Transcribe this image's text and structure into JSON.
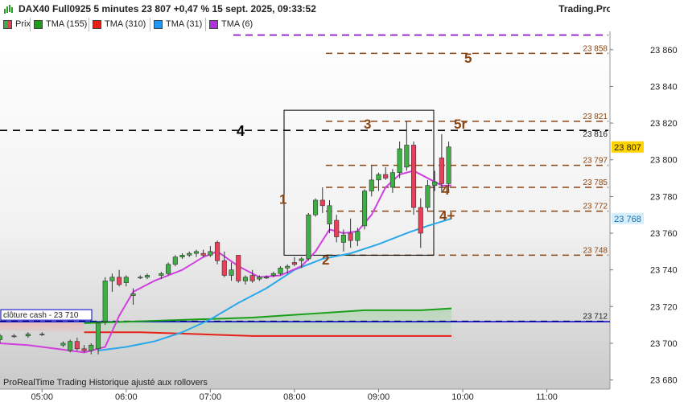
{
  "header": {
    "title": "DAX40 Full0925 5 minutes 23 807 +0,47 % 15 sept. 2025, 09:33:52",
    "brand": "Trading.ProRealTime.com"
  },
  "legend": [
    {
      "label": "Prix",
      "color": "#3cb043"
    },
    {
      "label": "TMA (155)",
      "color": "#1a9e1a"
    },
    {
      "label": "TMA (310)",
      "color": "#e8201a"
    },
    {
      "label": "TMA (31)",
      "color": "#2196f3"
    },
    {
      "label": "TMA (6)",
      "color": "#b030e0"
    }
  ],
  "footnote": "ProRealTime Trading  Historique ajusté aux rollovers",
  "colors": {
    "up": "#3cb043",
    "down": "#e8405a",
    "level": "#8b4513",
    "black_level": "#000000",
    "purple_level": "#9b30d0",
    "cash_line": "#0000cc"
  },
  "chart_data": {
    "type": "candlestick",
    "title": "DAX40 Full0925 5 minutes",
    "ylim": [
      23675,
      23870
    ],
    "yticks": [
      23680,
      23700,
      23720,
      23740,
      23760,
      23780,
      23800,
      23820,
      23840,
      23860
    ],
    "ytick_labels": [
      "23 680",
      "23 700",
      "23 720",
      "23 740",
      "23 760",
      "23 780",
      "23 800",
      "23 820",
      "23 840",
      "23 860"
    ],
    "xticks": [
      {
        "t": "05:00",
        "m": 300
      },
      {
        "t": "06:00",
        "m": 360
      },
      {
        "t": "07:00",
        "m": 420
      },
      {
        "t": "08:00",
        "m": 480
      },
      {
        "t": "09:00",
        "m": 540
      },
      {
        "t": "10:00",
        "m": 600
      },
      {
        "t": "11:00",
        "m": 660
      }
    ],
    "xlim_minutes": [
      270,
      705
    ],
    "candles": [
      {
        "m": 270,
        "o": 23702,
        "h": 23705,
        "l": 23700,
        "c": 23704
      },
      {
        "m": 280,
        "o": 23704,
        "h": 23705,
        "l": 23703,
        "c": 23704
      },
      {
        "m": 290,
        "o": 23704,
        "h": 23706,
        "l": 23703,
        "c": 23705
      },
      {
        "m": 300,
        "o": 23705,
        "h": 23706,
        "l": 23704,
        "c": 23705
      },
      {
        "m": 315,
        "o": 23699,
        "h": 23701,
        "l": 23698,
        "c": 23700
      },
      {
        "m": 320,
        "o": 23696,
        "h": 23702,
        "l": 23695,
        "c": 23701
      },
      {
        "m": 325,
        "o": 23701,
        "h": 23703,
        "l": 23696,
        "c": 23697
      },
      {
        "m": 330,
        "o": 23697,
        "h": 23699,
        "l": 23695,
        "c": 23696
      },
      {
        "m": 335,
        "o": 23696,
        "h": 23700,
        "l": 23694,
        "c": 23699
      },
      {
        "m": 340,
        "o": 23697,
        "h": 23712,
        "l": 23694,
        "c": 23711
      },
      {
        "m": 345,
        "o": 23712,
        "h": 23736,
        "l": 23710,
        "c": 23734
      },
      {
        "m": 350,
        "o": 23734,
        "h": 23738,
        "l": 23728,
        "c": 23736
      },
      {
        "m": 355,
        "o": 23736,
        "h": 23740,
        "l": 23731,
        "c": 23732
      },
      {
        "m": 360,
        "o": 23733,
        "h": 23737,
        "l": 23731,
        "c": 23736
      },
      {
        "m": 365,
        "o": 23726,
        "h": 23730,
        "l": 23721,
        "c": 23727
      },
      {
        "m": 370,
        "o": 23736,
        "h": 23737,
        "l": 23735,
        "c": 23736
      },
      {
        "m": 375,
        "o": 23736,
        "h": 23738,
        "l": 23735,
        "c": 23737
      },
      {
        "m": 385,
        "o": 23737,
        "h": 23739,
        "l": 23735,
        "c": 23738
      },
      {
        "m": 390,
        "o": 23738,
        "h": 23744,
        "l": 23737,
        "c": 23743
      },
      {
        "m": 395,
        "o": 23743,
        "h": 23748,
        "l": 23742,
        "c": 23747
      },
      {
        "m": 400,
        "o": 23747,
        "h": 23749,
        "l": 23746,
        "c": 23748
      },
      {
        "m": 405,
        "o": 23748,
        "h": 23750,
        "l": 23747,
        "c": 23749
      },
      {
        "m": 410,
        "o": 23749,
        "h": 23751,
        "l": 23747,
        "c": 23750
      },
      {
        "m": 415,
        "o": 23749,
        "h": 23751,
        "l": 23747,
        "c": 23748
      },
      {
        "m": 420,
        "o": 23748,
        "h": 23753,
        "l": 23747,
        "c": 23750
      },
      {
        "m": 425,
        "o": 23755,
        "h": 23756,
        "l": 23743,
        "c": 23745
      },
      {
        "m": 430,
        "o": 23745,
        "h": 23750,
        "l": 23736,
        "c": 23737
      },
      {
        "m": 435,
        "o": 23737,
        "h": 23744,
        "l": 23734,
        "c": 23740
      },
      {
        "m": 440,
        "o": 23748,
        "h": 23748,
        "l": 23733,
        "c": 23734
      },
      {
        "m": 445,
        "o": 23734,
        "h": 23737,
        "l": 23732,
        "c": 23736
      },
      {
        "m": 450,
        "o": 23737,
        "h": 23740,
        "l": 23733,
        "c": 23734
      },
      {
        "m": 455,
        "o": 23735,
        "h": 23737,
        "l": 23734,
        "c": 23736
      },
      {
        "m": 460,
        "o": 23736,
        "h": 23737,
        "l": 23735,
        "c": 23736
      },
      {
        "m": 465,
        "o": 23737,
        "h": 23739,
        "l": 23736,
        "c": 23738
      },
      {
        "m": 470,
        "o": 23738,
        "h": 23742,
        "l": 23737,
        "c": 23741
      },
      {
        "m": 475,
        "o": 23741,
        "h": 23743,
        "l": 23738,
        "c": 23742
      },
      {
        "m": 480,
        "o": 23744,
        "h": 23747,
        "l": 23742,
        "c": 23743
      },
      {
        "m": 485,
        "o": 23745,
        "h": 23747,
        "l": 23741,
        "c": 23746
      },
      {
        "m": 490,
        "o": 23746,
        "h": 23771,
        "l": 23745,
        "c": 23770
      },
      {
        "m": 495,
        "o": 23770,
        "h": 23779,
        "l": 23769,
        "c": 23778
      },
      {
        "m": 500,
        "o": 23778,
        "h": 23785,
        "l": 23771,
        "c": 23775
      },
      {
        "m": 505,
        "o": 23765,
        "h": 23778,
        "l": 23760,
        "c": 23775
      },
      {
        "m": 510,
        "o": 23767,
        "h": 23770,
        "l": 23755,
        "c": 23758
      },
      {
        "m": 515,
        "o": 23755,
        "h": 23762,
        "l": 23750,
        "c": 23759
      },
      {
        "m": 520,
        "o": 23760,
        "h": 23768,
        "l": 23752,
        "c": 23756
      },
      {
        "m": 525,
        "o": 23756,
        "h": 23763,
        "l": 23753,
        "c": 23761
      },
      {
        "m": 530,
        "o": 23764,
        "h": 23784,
        "l": 23762,
        "c": 23783
      },
      {
        "m": 535,
        "o": 23783,
        "h": 23797,
        "l": 23780,
        "c": 23789
      },
      {
        "m": 540,
        "o": 23789,
        "h": 23793,
        "l": 23783,
        "c": 23792
      },
      {
        "m": 545,
        "o": 23792,
        "h": 23796,
        "l": 23789,
        "c": 23790
      },
      {
        "m": 550,
        "o": 23785,
        "h": 23795,
        "l": 23782,
        "c": 23793
      },
      {
        "m": 555,
        "o": 23793,
        "h": 23810,
        "l": 23790,
        "c": 23806
      },
      {
        "m": 560,
        "o": 23796,
        "h": 23821,
        "l": 23794,
        "c": 23808
      },
      {
        "m": 565,
        "o": 23808,
        "h": 23810,
        "l": 23770,
        "c": 23774
      },
      {
        "m": 570,
        "o": 23774,
        "h": 23779,
        "l": 23752,
        "c": 23760
      },
      {
        "m": 575,
        "o": 23774,
        "h": 23789,
        "l": 23772,
        "c": 23786
      },
      {
        "m": 580,
        "o": 23786,
        "h": 23794,
        "l": 23783,
        "c": 23788
      },
      {
        "m": 585,
        "o": 23801,
        "h": 23814,
        "l": 23782,
        "c": 23787
      },
      {
        "m": 590,
        "o": 23787,
        "h": 23810,
        "l": 23782,
        "c": 23807
      }
    ],
    "tma_6": [
      [
        270,
        23700
      ],
      [
        290,
        23699
      ],
      [
        310,
        23697
      ],
      [
        330,
        23695
      ],
      [
        345,
        23698
      ],
      [
        355,
        23715
      ],
      [
        365,
        23728
      ],
      [
        380,
        23734
      ],
      [
        400,
        23740
      ],
      [
        415,
        23747
      ],
      [
        425,
        23750
      ],
      [
        440,
        23742
      ],
      [
        455,
        23736
      ],
      [
        470,
        23737
      ],
      [
        485,
        23742
      ],
      [
        495,
        23750
      ],
      [
        505,
        23762
      ],
      [
        515,
        23760
      ],
      [
        525,
        23761
      ],
      [
        535,
        23770
      ],
      [
        545,
        23785
      ],
      [
        555,
        23792
      ],
      [
        565,
        23794
      ],
      [
        575,
        23790
      ],
      [
        585,
        23786
      ],
      [
        592,
        23786
      ]
    ],
    "tma_31": [
      [
        340,
        23696
      ],
      [
        360,
        23698
      ],
      [
        380,
        23701
      ],
      [
        400,
        23706
      ],
      [
        420,
        23713
      ],
      [
        440,
        23722
      ],
      [
        460,
        23730
      ],
      [
        480,
        23740
      ],
      [
        500,
        23746
      ],
      [
        520,
        23749
      ],
      [
        540,
        23754
      ],
      [
        560,
        23760
      ],
      [
        575,
        23764
      ],
      [
        592,
        23768
      ]
    ],
    "tma_155": [
      [
        330,
        23711
      ],
      [
        370,
        23712
      ],
      [
        410,
        23713
      ],
      [
        450,
        23714
      ],
      [
        490,
        23716
      ],
      [
        530,
        23718
      ],
      [
        570,
        23718
      ],
      [
        592,
        23719
      ]
    ],
    "tma_310": [
      [
        330,
        23706
      ],
      [
        370,
        23706
      ],
      [
        410,
        23705
      ],
      [
        450,
        23704
      ],
      [
        490,
        23704
      ],
      [
        530,
        23704
      ],
      [
        570,
        23704
      ],
      [
        592,
        23704
      ]
    ],
    "levels": [
      {
        "value": 23858,
        "label": "23 858",
        "marker": "5"
      },
      {
        "value": 23821,
        "label": "23 821",
        "marker": "5r"
      },
      {
        "value": 23797,
        "label": "23 797",
        "marker": ""
      },
      {
        "value": 23785,
        "label": "23 785",
        "marker": "4"
      },
      {
        "value": 23772,
        "label": "23 772",
        "marker": "4+"
      },
      {
        "value": 23748,
        "label": "23 748",
        "marker": "2"
      },
      {
        "value": 23712,
        "label": "23 712",
        "marker": ""
      }
    ],
    "black_level": {
      "value": 23816,
      "label": "23 816",
      "marker": "4"
    },
    "purple_level": {
      "value": 23868
    },
    "cash_close": {
      "value": 23710,
      "label": "clôture cash -  23 710"
    },
    "box_markers": {
      "one": "1",
      "three": "3"
    },
    "current_price": {
      "value": 23807,
      "label": "23 807"
    },
    "tma31_last": {
      "value": 23768,
      "label": "23 768"
    }
  }
}
